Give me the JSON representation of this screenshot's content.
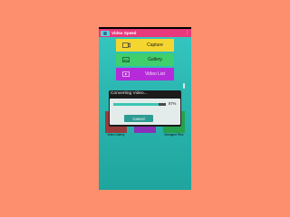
{
  "app": {
    "title": "Video Speed"
  },
  "menu": {
    "capture_label": "Capture",
    "gallery_label": "Gallery",
    "videolist_label": "Video List"
  },
  "grid": [
    {
      "label": "Video Gallery"
    },
    {
      "label": ""
    },
    {
      "label": "Managed Files"
    }
  ],
  "dialog": {
    "title": "Converting Video...",
    "progress_percent": 87,
    "progress_text": "87%",
    "cancel_label": "Cancel"
  },
  "colors": {
    "appbar": "#e7397c",
    "capture": "#f5d631",
    "gallery": "#3fcf6c",
    "videolist": "#b52bd9",
    "accent": "#3cc7b5"
  }
}
